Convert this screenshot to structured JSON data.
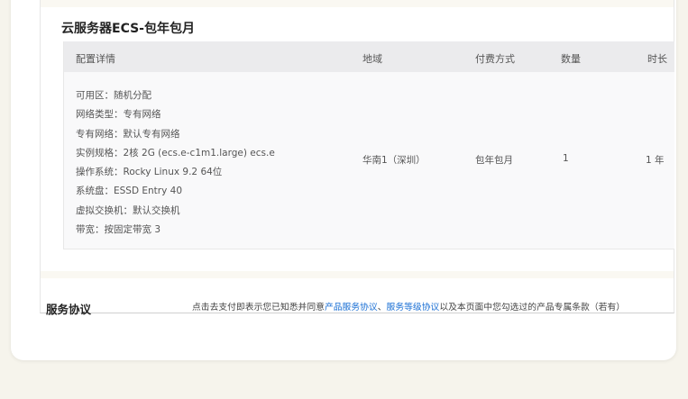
{
  "product": {
    "title": "云服务器ECS-包年包月",
    "table": {
      "headers": {
        "config": "配置详情",
        "region": "地域",
        "payment": "付费方式",
        "quantity": "数量",
        "duration": "时长"
      },
      "specs": [
        "可用区：随机分配",
        "网络类型：专有网络",
        "专有网络：默认专有网络",
        "实例规格：2核 2G (ecs.e-c1m1.large) ecs.e",
        "操作系统：Rocky Linux 9.2 64位",
        "系统盘：ESSD Entry 40",
        "虚拟交换机：默认交换机",
        "带宽：按固定带宽 3"
      ],
      "region": "华南1（深圳）",
      "payment": "包年包月",
      "quantity": "1",
      "duration": "1 年"
    }
  },
  "agreement": {
    "title": "服务协议",
    "text_prefix": "点击去支付即表示您已知悉并同意",
    "link1": "产品服务协议",
    "separator": "、",
    "link2": "服务等级协议",
    "text_suffix": "以及本页面中您勾选过的产品专属条款（若有）"
  }
}
